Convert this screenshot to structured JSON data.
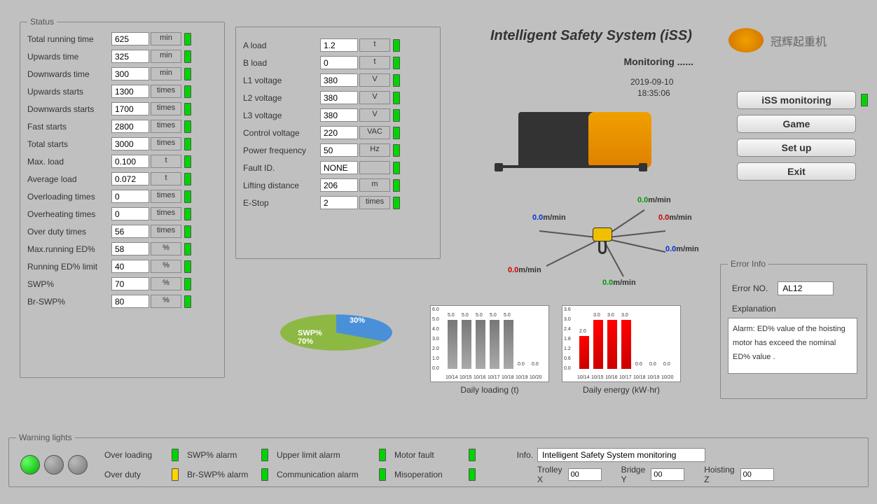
{
  "title": "Intelligent Safety System (iSS)",
  "subtitle": "Monitoring ......",
  "date": "2019-09-10",
  "time": "18:35:06",
  "brand": "冠辉起重机",
  "status_legend": "Status",
  "status": [
    {
      "label": "Total running time",
      "val": "625",
      "unit": "min"
    },
    {
      "label": "Upwards time",
      "val": "325",
      "unit": "min"
    },
    {
      "label": "Downwards time",
      "val": "300",
      "unit": "min"
    },
    {
      "label": "Upwards starts",
      "val": "1300",
      "unit": "times"
    },
    {
      "label": "Downwards starts",
      "val": "1700",
      "unit": "times"
    },
    {
      "label": "Fast starts",
      "val": "2800",
      "unit": "times"
    },
    {
      "label": "Total starts",
      "val": "3000",
      "unit": "times"
    },
    {
      "label": "Max. load",
      "val": "0.100",
      "unit": "t"
    },
    {
      "label": "Average load",
      "val": "0.072",
      "unit": "t"
    },
    {
      "label": "Overloading times",
      "val": "0",
      "unit": "times"
    },
    {
      "label": "Overheating times",
      "val": "0",
      "unit": "times"
    },
    {
      "label": "Over duty times",
      "val": "56",
      "unit": "times"
    },
    {
      "label": "Max.running ED%",
      "val": "58",
      "unit": "%"
    },
    {
      "label": "Running ED% limit",
      "val": "40",
      "unit": "%"
    },
    {
      "label": "SWP%",
      "val": "70",
      "unit": "%"
    },
    {
      "label": "Br-SWP%",
      "val": "80",
      "unit": "%"
    }
  ],
  "panel2": [
    {
      "label": "A load",
      "val": "1.2",
      "unit": "t"
    },
    {
      "label": "B load",
      "val": "0",
      "unit": "t"
    },
    {
      "label": "L1 voltage",
      "val": "380",
      "unit": "V"
    },
    {
      "label": "L2 voltage",
      "val": "380",
      "unit": "V"
    },
    {
      "label": "L3 voltage",
      "val": "380",
      "unit": "V"
    },
    {
      "label": "Control voltage",
      "val": "220",
      "unit": "VAC"
    },
    {
      "label": "Power frequency",
      "val": "50",
      "unit": "Hz"
    },
    {
      "label": "Fault ID.",
      "val": "NONE",
      "unit": ""
    },
    {
      "label": "Lifting distance",
      "val": "206",
      "unit": "m"
    },
    {
      "label": "E-Stop",
      "val": "2",
      "unit": "times"
    }
  ],
  "nav": {
    "b1": "iSS monitoring",
    "b2": "Game",
    "b3": "Set up",
    "b4": "Exit"
  },
  "error_legend": "Error Info",
  "error_no_label": "Error NO.",
  "error_no": "AL12",
  "explanation_label": "Explanation",
  "explanation": "Alarm: ED% value of the hoisting motor has exceed the nominal ED% value .",
  "warn_legend": "Warning lights",
  "warn": {
    "overloading": "Over loading",
    "overduty": "Over duty",
    "swp": "SWP% alarm",
    "brswp": "Br-SWP% alarm",
    "upper": "Upper limit alarm",
    "comm": "Communication alarm",
    "motor": "Motor fault",
    "misop": "Misoperation"
  },
  "info_label": "Info.",
  "info": "Intelligent Safety System monitoring",
  "trolley_label": "Trolley X",
  "trolley": "00",
  "bridge_label": "Bridge Y",
  "bridge": "00",
  "hoist_label": "Hoisting Z",
  "hoist": "00",
  "speeds": [
    {
      "v": "0.0",
      "u": "m/min",
      "cls": "green"
    },
    {
      "v": "0.0",
      "u": "m/min",
      "cls": "red"
    },
    {
      "v": "0.0",
      "u": "m/min",
      "cls": "blue"
    },
    {
      "v": "0.0",
      "u": "m/min",
      "cls": "blue"
    },
    {
      "v": "0.0",
      "u": "m/min",
      "cls": "red"
    },
    {
      "v": "0.0",
      "u": "m/min",
      "cls": "green"
    }
  ],
  "chart_data": [
    {
      "type": "pie",
      "title": "",
      "series": [
        {
          "name": "SWP%",
          "value": 70
        },
        {
          "name": "",
          "value": 30
        }
      ],
      "labels": [
        "SWP% 70%",
        "30%"
      ]
    },
    {
      "type": "bar",
      "title": "Daily loading (t)",
      "categories": [
        "10/14",
        "10/15",
        "10/16",
        "10/17",
        "10/18",
        "10/19",
        "10/20"
      ],
      "values": [
        5.0,
        5.0,
        5.0,
        5.0,
        5.0,
        0.0,
        0.0
      ],
      "ylim": [
        0,
        6
      ],
      "yticks": [
        0.0,
        1.0,
        2.0,
        3.0,
        4.0,
        5.0,
        6.0
      ]
    },
    {
      "type": "bar",
      "title": "Daily energy (kW·hr)",
      "categories": [
        "10/14",
        "10/15",
        "10/16",
        "10/17",
        "10/18",
        "10/19",
        "10/20"
      ],
      "values": [
        2.0,
        3.0,
        3.0,
        3.0,
        0.0,
        0.0,
        0.0
      ],
      "ylim": [
        0,
        3.6
      ],
      "yticks": [
        0.0,
        0.6,
        1.2,
        1.8,
        2.4,
        3.0,
        3.6
      ]
    }
  ]
}
